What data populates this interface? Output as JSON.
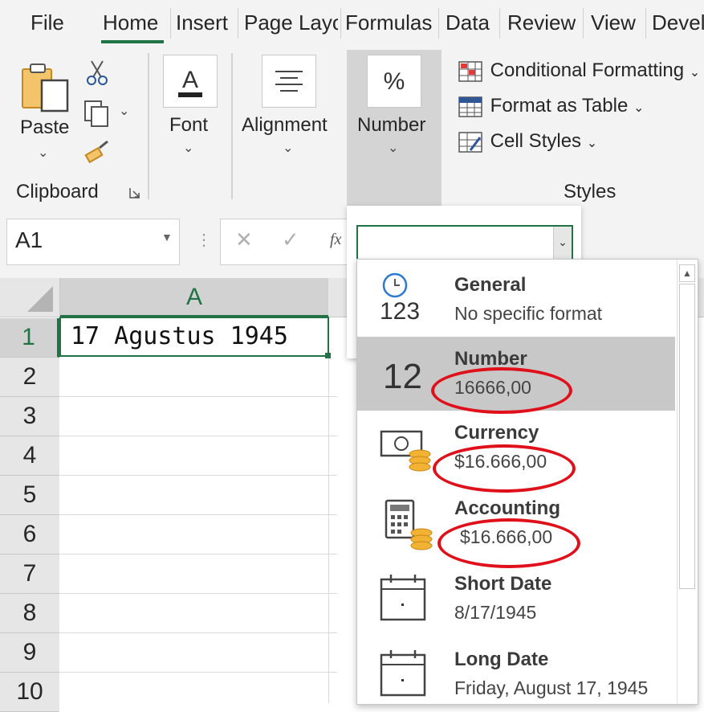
{
  "tabs": [
    "File",
    "Home",
    "Insert",
    "Page Layout",
    "Formulas",
    "Data",
    "Review",
    "View",
    "Developer"
  ],
  "ribbon": {
    "clipboard": {
      "paste_label": "Paste",
      "group_label": "Clipboard"
    },
    "font": {
      "label": "Font"
    },
    "alignment": {
      "label": "Alignment"
    },
    "number": {
      "label": "Number"
    },
    "styles": {
      "conditional_formatting": "Conditional Formatting",
      "format_as_table": "Format as Table",
      "cell_styles": "Cell Styles",
      "group_label": "Styles"
    }
  },
  "formula_bar": {
    "name_box": "A1",
    "fx_label": "fx"
  },
  "grid": {
    "column_header": "A",
    "rows": [
      "1",
      "2",
      "3",
      "4",
      "5",
      "6",
      "7",
      "8",
      "9",
      "10"
    ],
    "a1_value": "17 Agustus 1945"
  },
  "number_format": {
    "combo_value": "",
    "options": [
      {
        "name": "General",
        "example": "No specific format",
        "icon": "clock-123-icon"
      },
      {
        "name": "Number",
        "example": "16666,00",
        "icon": "number-12-icon",
        "selected": true
      },
      {
        "name": "Currency",
        "example": "$16.666,00",
        "icon": "currency-icon"
      },
      {
        "name": "Accounting",
        "example": "$16.666,00",
        "icon": "accounting-icon"
      },
      {
        "name": "Short Date",
        "example": "8/17/1945",
        "icon": "calendar-icon"
      },
      {
        "name": "Long Date",
        "example": "Friday, August 17, 1945",
        "icon": "calendar-icon"
      }
    ]
  },
  "colors": {
    "accent": "#217346",
    "annotation": "#e0101a",
    "selected_row": "#c8c8c8"
  }
}
